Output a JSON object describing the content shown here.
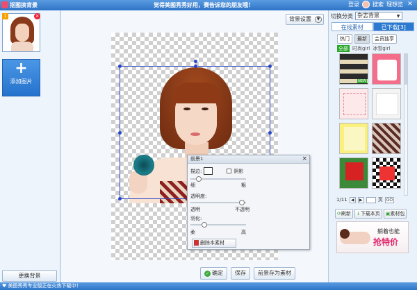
{
  "titlebar": {
    "app_title": "抠图换背景",
    "center_message": "觉得美图秀秀好用，赛告诉您的朋友哦！",
    "login": "登录",
    "look": "搜索",
    "grid_view": "理想览",
    "close": "✕"
  },
  "left": {
    "thumb_badge": "1",
    "add_label": "添加图片",
    "change_bg": "更换背景"
  },
  "main": {
    "bg_settings": "背景设置",
    "fg_panel": {
      "title": "前景1",
      "stroke_label": "描边:",
      "shadow_label": "阴影",
      "thin_label": "细",
      "thick_label": "粗",
      "opacity_label": "透明度:",
      "transparent": "透明",
      "opaque": "不透明",
      "feather_label": "羽化:",
      "soft_label": "柔",
      "hard_label": "高",
      "delete_btn": "删除本素材"
    },
    "buttons": {
      "confirm": "确定",
      "save": "保存",
      "save_fg": "前景存为素材"
    }
  },
  "right": {
    "switch_label": "切换分类",
    "category": "杂志背景",
    "tab_online": "在线素材",
    "tab_downloaded": "已下载[3]",
    "subtabs": [
      "热门",
      "最新",
      "会员独享"
    ],
    "filters": [
      "全部",
      "时尚girl",
      "冰雪girl"
    ],
    "pager_text": "1/11",
    "page_label": "页",
    "go": "GO",
    "actions": [
      "刷新",
      "下载本页",
      "素材包"
    ],
    "ad_line1": "躺着也能",
    "ad_line2": "抢特价",
    "new_badge": "NEW"
  },
  "status": "♥ 美图秀秀专业版正在火热下载中！"
}
